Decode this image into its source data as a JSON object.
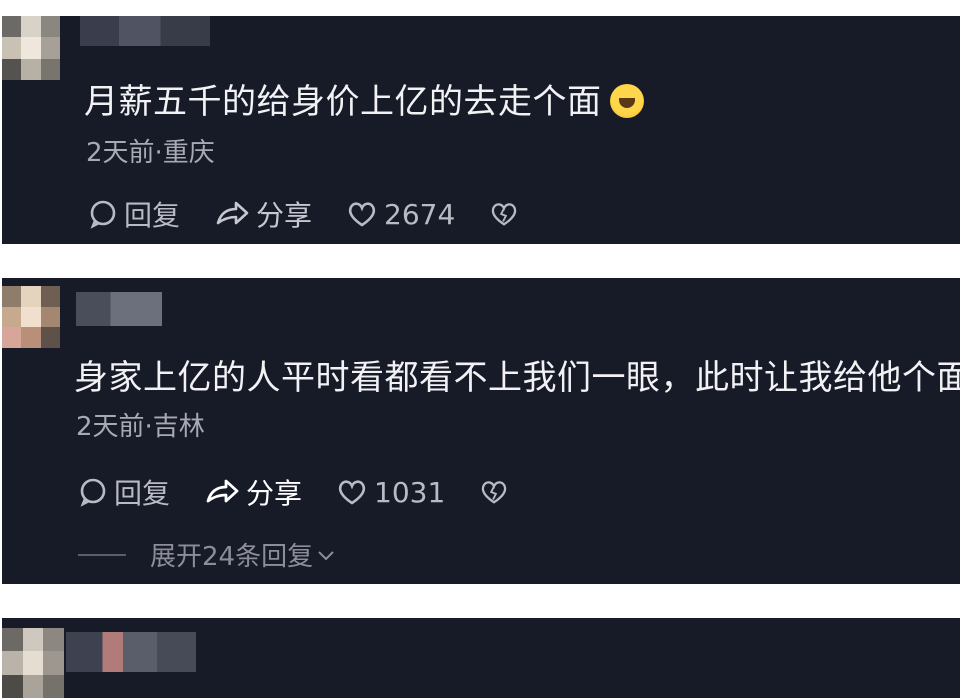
{
  "comments": [
    {
      "text": "月薪五千的给身价上亿的去走个面",
      "emoji": "laughing-tears-emoji",
      "meta": "2天前·重庆",
      "reply_label": "回复",
      "share_label": "分享",
      "likes": "2674"
    },
    {
      "text": "身家上亿的人平时看都看不上我们一眼，此时让我给他个面",
      "meta": "2天前·吉林",
      "reply_label": "回复",
      "share_label": "分享",
      "likes": "1031",
      "expand_label": "展开24条回复"
    }
  ],
  "colors": {
    "card_bg": "#171a27",
    "text": "#f2f2f5",
    "meta": "#a7a9b3"
  }
}
